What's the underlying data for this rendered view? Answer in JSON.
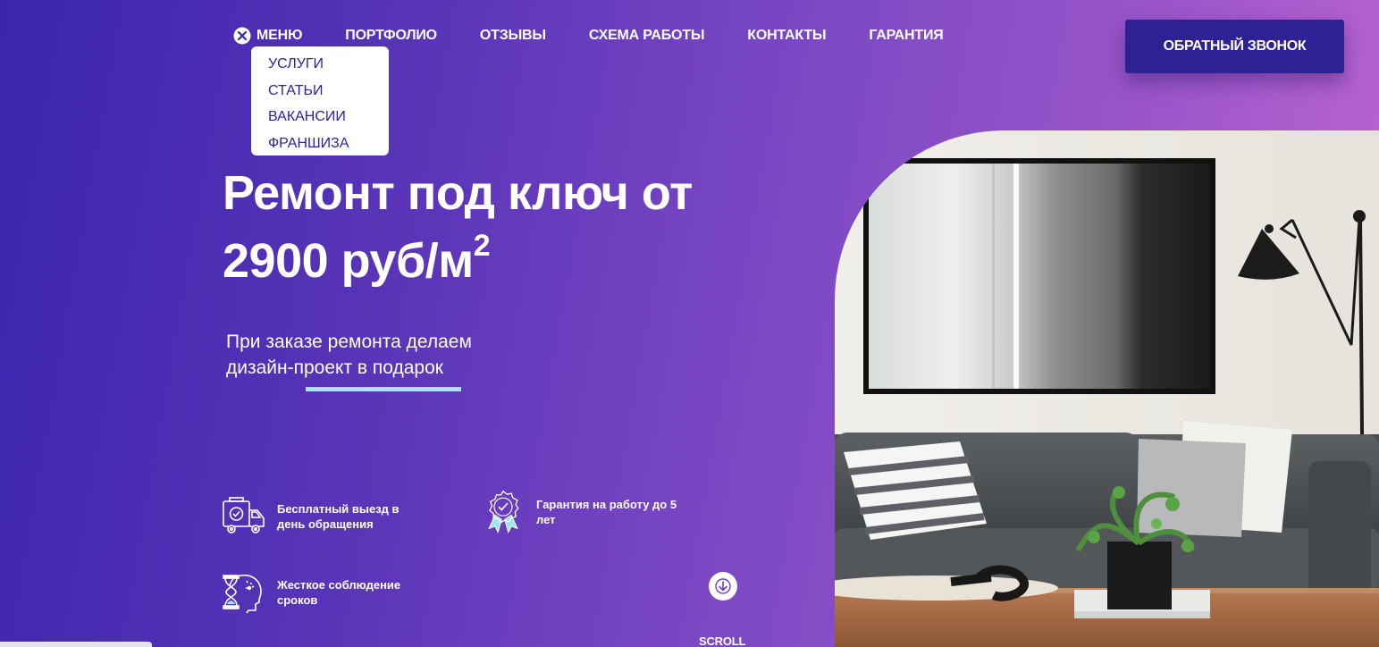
{
  "nav": {
    "menu_label": "МЕНЮ",
    "links": [
      "ПОРТФОЛИО",
      "ОТЗЫВЫ",
      "СХЕМА РАБОТЫ",
      "КОНТАКТЫ",
      "ГАРАНТИЯ"
    ],
    "dropdown": [
      "УСЛУГИ",
      "СТАТЬИ",
      "ВАКАНСИИ",
      "ФРАНШИЗА"
    ]
  },
  "header": {
    "callback_label": "ОБРАТНЫЙ ЗВОНОК"
  },
  "hero": {
    "title_line1": "Ремонт под ключ от",
    "title_line2": "2900 руб/м",
    "title_sup": "2",
    "subtitle": "При заказе ремонта делаем дизайн-проект в подарок"
  },
  "features": {
    "free_visit": "Бесплатный выезд в день обращения",
    "warranty": "Гарантия на работу до 5 лет",
    "deadlines": "Жесткое соблюдение сроков"
  },
  "scroll": {
    "label": "SCROLL"
  },
  "colors": {
    "gradient_start": "#3a25ad",
    "gradient_end": "#c066d3",
    "button_bg": "#2d2194",
    "accent_underline": "#a9e6f3",
    "dropdown_text": "#2e22a0"
  },
  "icons": {
    "close": "close-icon",
    "truck": "truck-icon",
    "badge": "warranty-badge-icon",
    "hourglass": "hourglass-head-icon",
    "arrow": "arrow-down-icon"
  }
}
